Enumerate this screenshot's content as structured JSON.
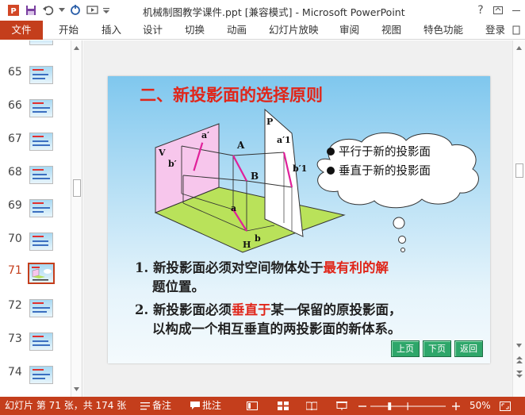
{
  "window": {
    "title": "机械制图教学课件.ppt [兼容模式] - Microsoft PowerPoint",
    "help": "?"
  },
  "ribbon": {
    "file_tab": "文件",
    "tabs": [
      "开始",
      "插入",
      "设计",
      "切换",
      "动画",
      "幻灯片放映",
      "审阅",
      "视图",
      "特色功能"
    ],
    "login": "登录"
  },
  "thumbnails": {
    "numbers": [
      "65",
      "66",
      "67",
      "68",
      "69",
      "70",
      "71",
      "72",
      "73",
      "74"
    ],
    "active": "71"
  },
  "slide": {
    "title": "二、新投影面的选择原则",
    "diagram_labels": {
      "V": "V",
      "H": "H",
      "P": "P",
      "A": "A",
      "B": "B",
      "a_prime": "a′",
      "b_prime": "b′",
      "a1_prime": "a′1",
      "b1_prime": "b′1",
      "a": "a",
      "b": "b"
    },
    "cloud": {
      "item1": "平行于新的投影面",
      "item2": "垂直于新的投影面"
    },
    "points": {
      "p1_num": "1.",
      "p1_a": "新投影面必须对空间物体处于",
      "p1_red": "最有利的解",
      "p1_line2": "题位置。",
      "p2_num": "2.",
      "p2_a": "新投影面必须",
      "p2_red": "垂直于",
      "p2_b": "某一保留的原投影面，",
      "p2_line2": "以构成一个相互垂直的两投影面的新体系。"
    },
    "nav": {
      "prev": "上页",
      "next": "下页",
      "back": "返回"
    }
  },
  "statusbar": {
    "slide_info": "幻灯片 第 71 张，共 174 张",
    "notes": "备注",
    "comments": "批注",
    "zoom": "50%"
  },
  "colors": {
    "accent": "#c43e1c",
    "title_red": "#e0261a",
    "nav_green": "#2ea66a",
    "v_plane": "#f7c6ec",
    "h_plane": "#b9e25a"
  }
}
